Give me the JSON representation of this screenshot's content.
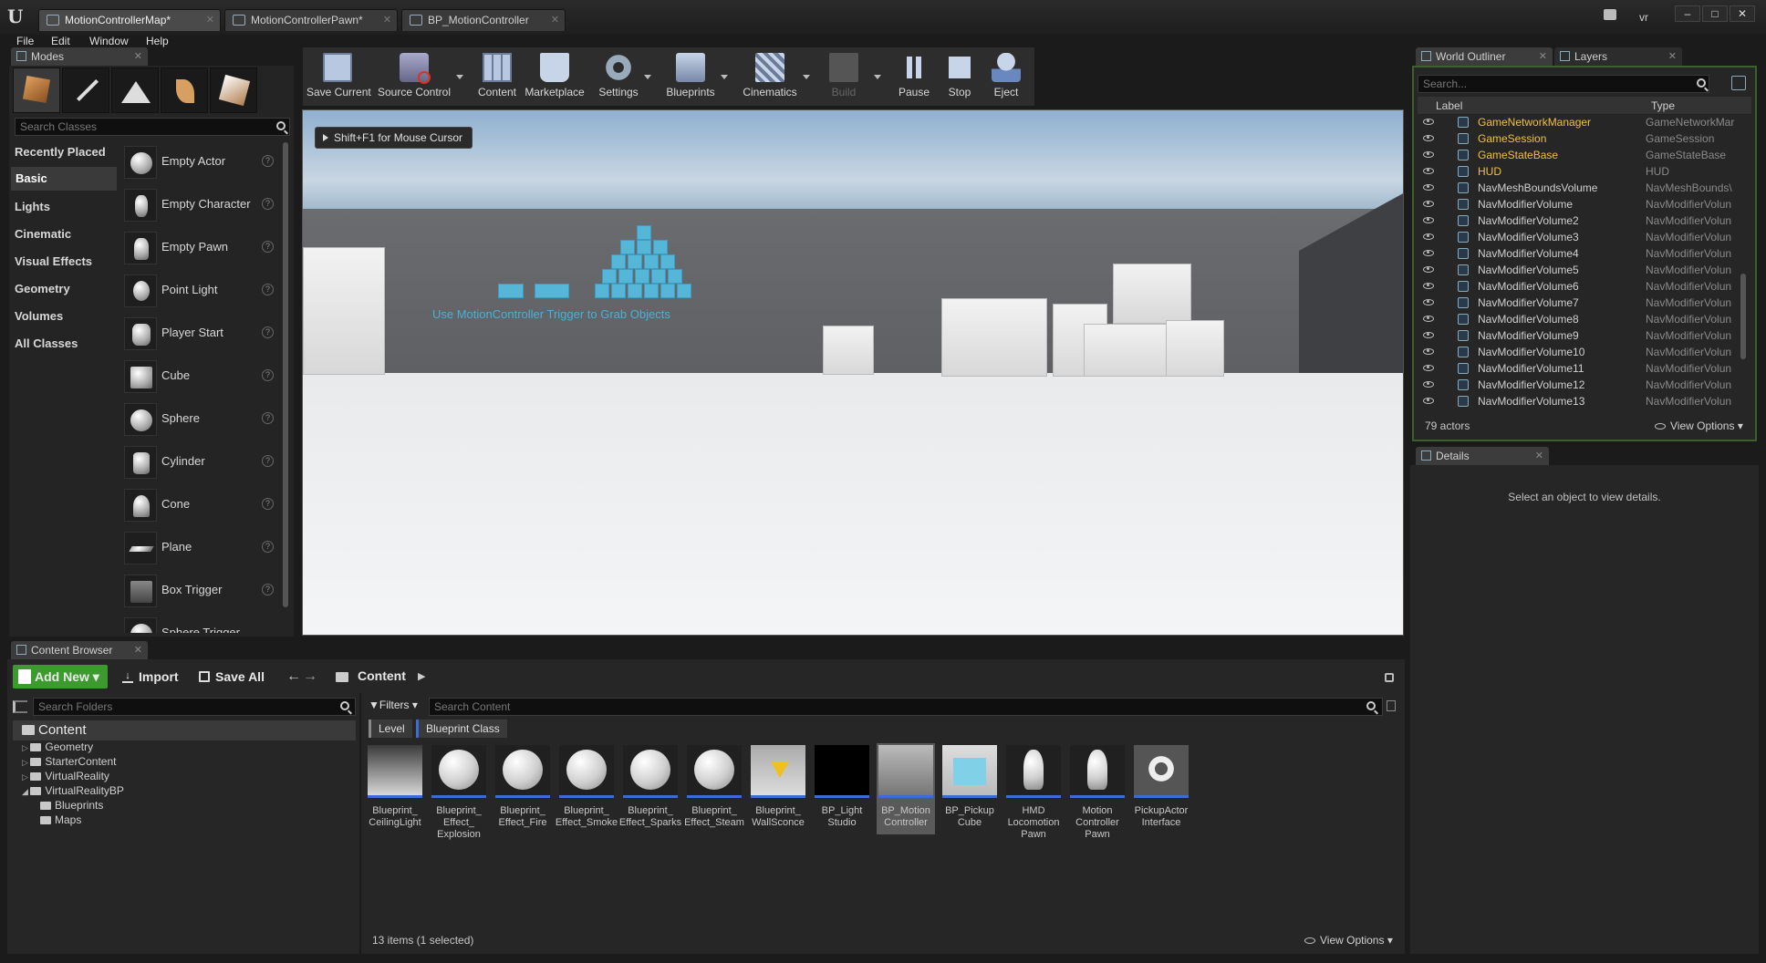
{
  "window": {
    "tabs": [
      {
        "label": "MotionControllerMap*"
      },
      {
        "label": "MotionControllerPawn*"
      },
      {
        "label": "BP_MotionController"
      }
    ],
    "user": "vr",
    "menu": [
      "File",
      "Edit",
      "Window",
      "Help"
    ]
  },
  "modes": {
    "title": "Modes",
    "search_placeholder": "Search Classes",
    "categories": [
      "Recently Placed",
      "Basic",
      "Lights",
      "Cinematic",
      "Visual Effects",
      "Geometry",
      "Volumes",
      "All Classes"
    ],
    "selected_category": "Basic",
    "items": [
      "Empty Actor",
      "Empty Character",
      "Empty Pawn",
      "Point Light",
      "Player Start",
      "Cube",
      "Sphere",
      "Cylinder",
      "Cone",
      "Plane",
      "Box Trigger",
      "Sphere Trigger"
    ]
  },
  "toolbar": {
    "buttons": [
      "Save Current",
      "Source Control",
      "Content",
      "Marketplace",
      "Settings",
      "Blueprints",
      "Cinematics",
      "Build",
      "Pause",
      "Stop",
      "Eject"
    ]
  },
  "viewport": {
    "hint": "Shift+F1 for Mouse Cursor",
    "scene_text": "Use MotionController Trigger to Grab Objects"
  },
  "outliner": {
    "tabs": [
      "World Outliner",
      "Layers"
    ],
    "search_placeholder": "Search...",
    "col_label": "Label",
    "col_type": "Type",
    "rows": [
      {
        "label": "GameNetworkManager",
        "type": "GameNetworkMar"
      },
      {
        "label": "GameSession",
        "type": "GameSession"
      },
      {
        "label": "GameStateBase",
        "type": "GameStateBase"
      },
      {
        "label": "HUD",
        "type": "HUD"
      },
      {
        "label": "NavMeshBoundsVolume",
        "type": "NavMeshBounds\\"
      },
      {
        "label": "NavModifierVolume",
        "type": "NavModifierVolun"
      },
      {
        "label": "NavModifierVolume2",
        "type": "NavModifierVolun"
      },
      {
        "label": "NavModifierVolume3",
        "type": "NavModifierVolun"
      },
      {
        "label": "NavModifierVolume4",
        "type": "NavModifierVolun"
      },
      {
        "label": "NavModifierVolume5",
        "type": "NavModifierVolun"
      },
      {
        "label": "NavModifierVolume6",
        "type": "NavModifierVolun"
      },
      {
        "label": "NavModifierVolume7",
        "type": "NavModifierVolun"
      },
      {
        "label": "NavModifierVolume8",
        "type": "NavModifierVolun"
      },
      {
        "label": "NavModifierVolume9",
        "type": "NavModifierVolun"
      },
      {
        "label": "NavModifierVolume10",
        "type": "NavModifierVolun"
      },
      {
        "label": "NavModifierVolume11",
        "type": "NavModifierVolun"
      },
      {
        "label": "NavModifierVolume12",
        "type": "NavModifierVolun"
      },
      {
        "label": "NavModifierVolume13",
        "type": "NavModifierVolun"
      }
    ],
    "count": "79 actors",
    "view_options": "View Options"
  },
  "details": {
    "title": "Details",
    "empty_text": "Select an object to view details."
  },
  "content_browser": {
    "title": "Content Browser",
    "add_new": "Add New",
    "import": "Import",
    "save_all": "Save All",
    "path": "Content",
    "search_folders_placeholder": "Search Folders",
    "filters": "Filters",
    "search_content_placeholder": "Search Content",
    "filter_chips": [
      "Level",
      "Blueprint Class"
    ],
    "tree_root": "Content",
    "tree": [
      {
        "label": "Geometry",
        "level": 1
      },
      {
        "label": "StarterContent",
        "level": 1
      },
      {
        "label": "VirtualReality",
        "level": 1
      },
      {
        "label": "VirtualRealityBP",
        "level": 1
      },
      {
        "label": "Blueprints",
        "level": 2
      },
      {
        "label": "Maps",
        "level": 2
      }
    ],
    "assets": [
      {
        "name": "Blueprint_\nCeilingLight"
      },
      {
        "name": "Blueprint_\nEffect_\nExplosion"
      },
      {
        "name": "Blueprint_\nEffect_Fire"
      },
      {
        "name": "Blueprint_\nEffect_Smoke"
      },
      {
        "name": "Blueprint_\nEffect_Sparks"
      },
      {
        "name": "Blueprint_\nEffect_Steam"
      },
      {
        "name": "Blueprint_\nWallSconce"
      },
      {
        "name": "BP_Light\nStudio"
      },
      {
        "name": "BP_Motion\nController"
      },
      {
        "name": "BP_Pickup\nCube"
      },
      {
        "name": "HMD\nLocomotion\nPawn"
      },
      {
        "name": "Motion\nController\nPawn"
      },
      {
        "name": "PickupActor\nInterface"
      }
    ],
    "status": "13 items (1 selected)",
    "view_options": "View Options"
  }
}
